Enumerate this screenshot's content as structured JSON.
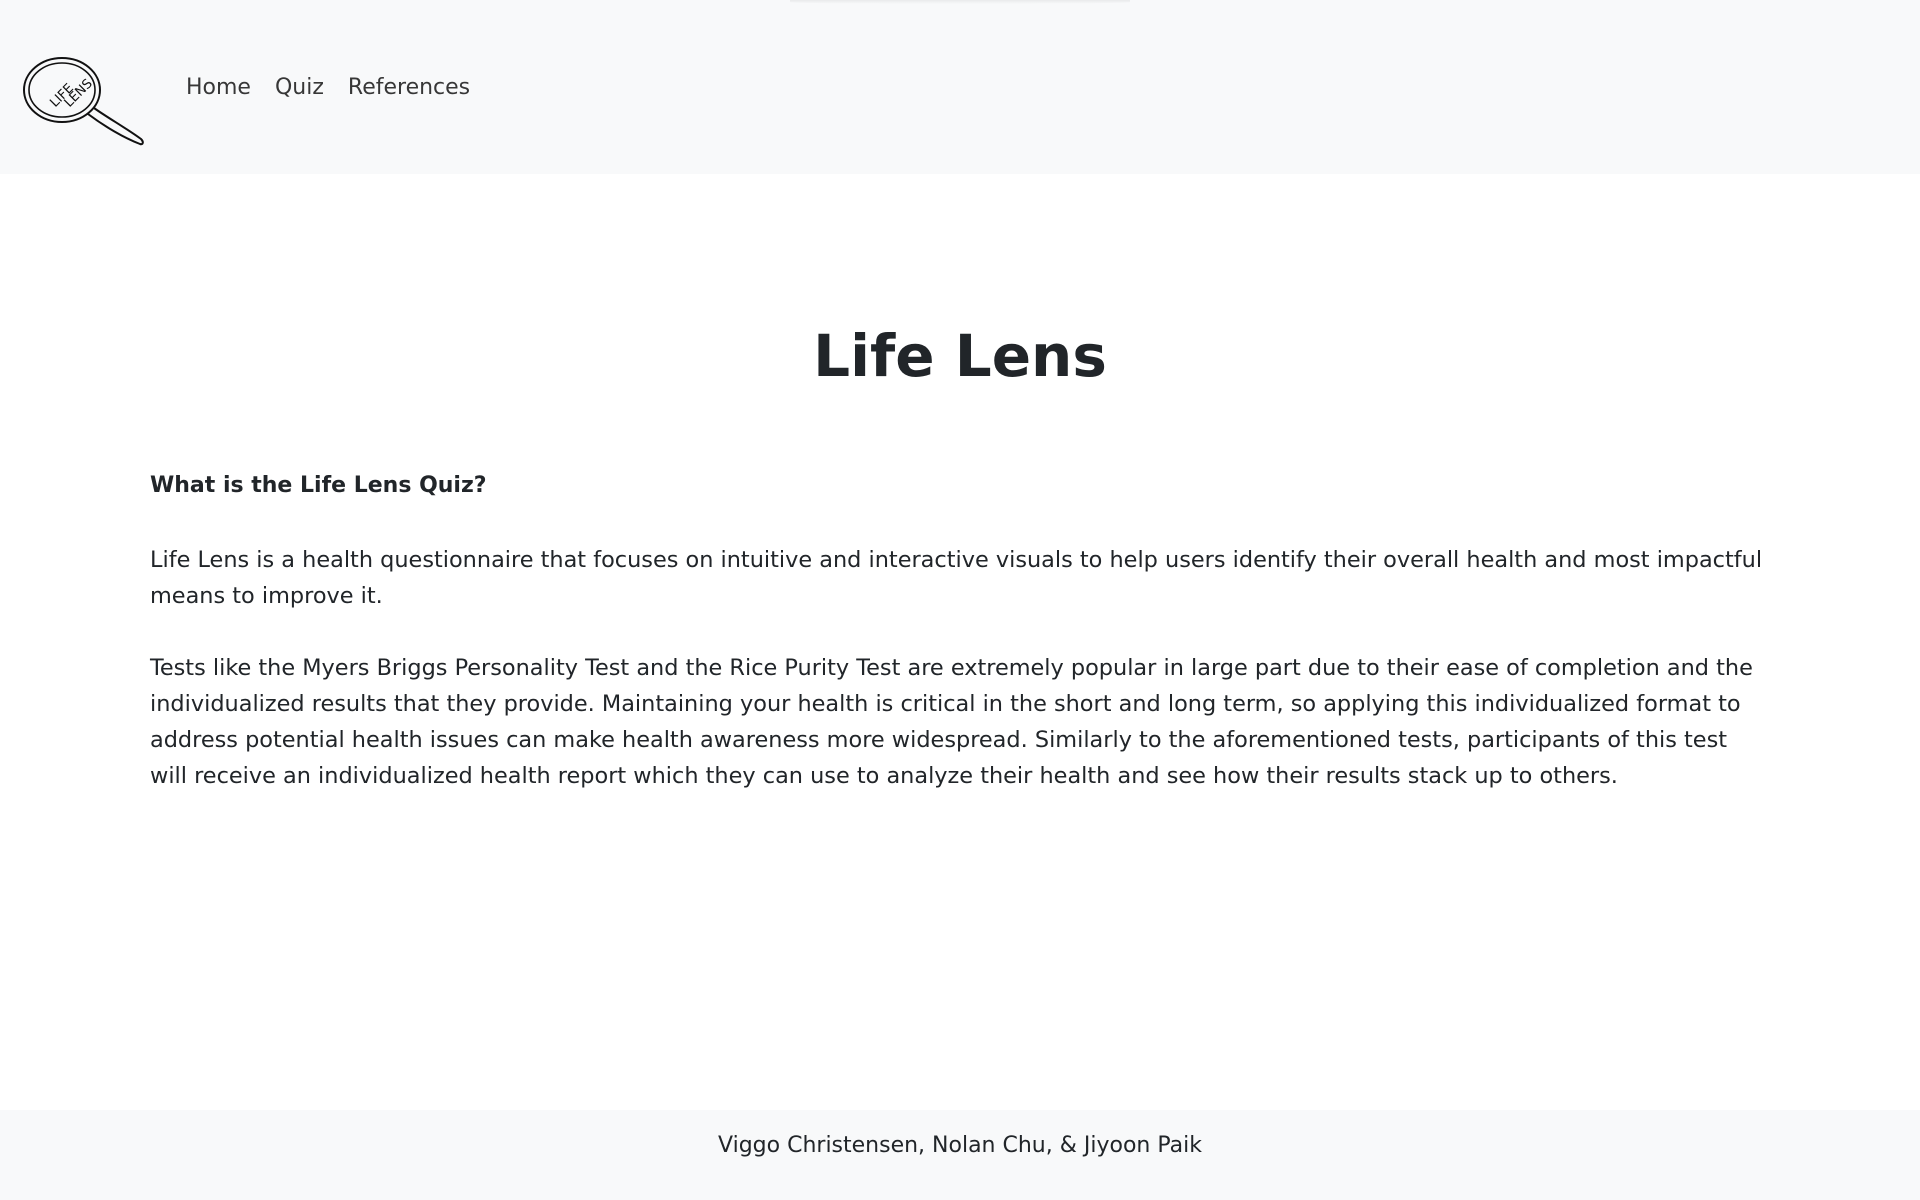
{
  "header": {
    "logo_text_line1": "LIFE",
    "logo_text_line2": "LENS",
    "nav": [
      {
        "label": "Home"
      },
      {
        "label": "Quiz"
      },
      {
        "label": "References"
      }
    ]
  },
  "main": {
    "title": "Life Lens",
    "section_heading": "What is the Life Lens Quiz?",
    "paragraphs": [
      "Life Lens is a health questionnaire that focuses on intuitive and interactive visuals to help users identify their overall health and most impactful means to improve it.",
      "Tests like the Myers Briggs Personality Test and the Rice Purity Test are extremely popular in large part due to their ease of completion and the individualized results that they provide. Maintaining your health is critical in the short and long term, so applying this individualized format to address potential health issues can make health awareness more widespread. Similarly to the aforementioned tests, participants of this test will receive an individualized health report which they can use to analyze their health and see how their results stack up to others."
    ]
  },
  "footer": {
    "credits": "Viggo Christensen, Nolan Chu, & Jiyoon Paik"
  },
  "colors": {
    "navbar_bg": "#f8f9fa",
    "text": "#212529",
    "page_bg": "#ffffff"
  }
}
